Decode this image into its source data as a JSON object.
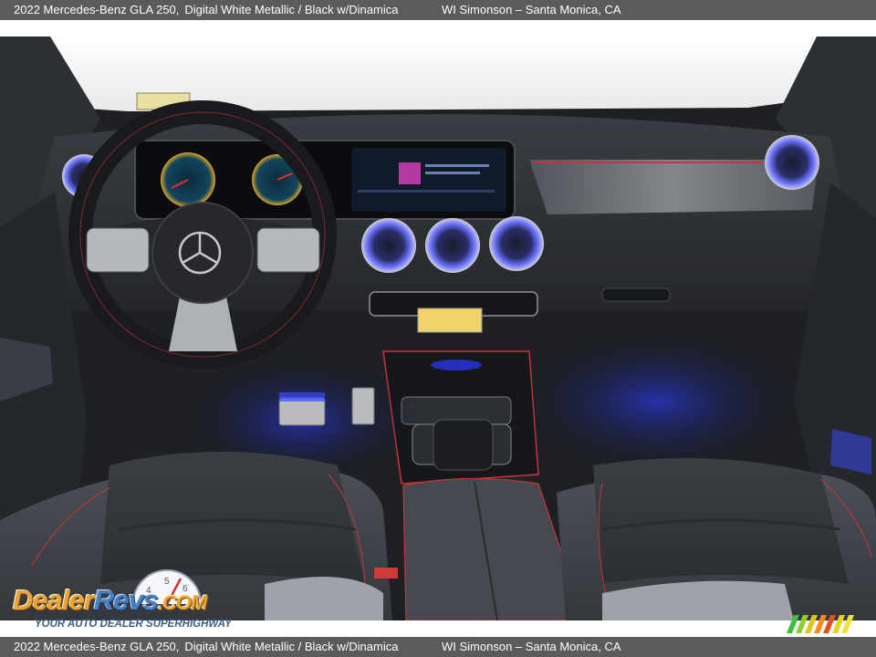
{
  "caption": {
    "vehicle": "2022 Mercedes-Benz GLA 250,",
    "color": "Digital White Metallic / Black w/Dinamica",
    "dealer": "WI Simonson – Santa Monica, CA"
  },
  "watermark": {
    "brand_dealer": "Dealer",
    "brand_revs": "Revs",
    "brand_com": ".COM",
    "tagline": "YOUR AUTO DEALER SUPERHIGHWAY"
  },
  "colors": {
    "caption_bar": "#5b5b5b",
    "ambient_blue": "#3a4dff",
    "accent_red": "#c8343a"
  }
}
